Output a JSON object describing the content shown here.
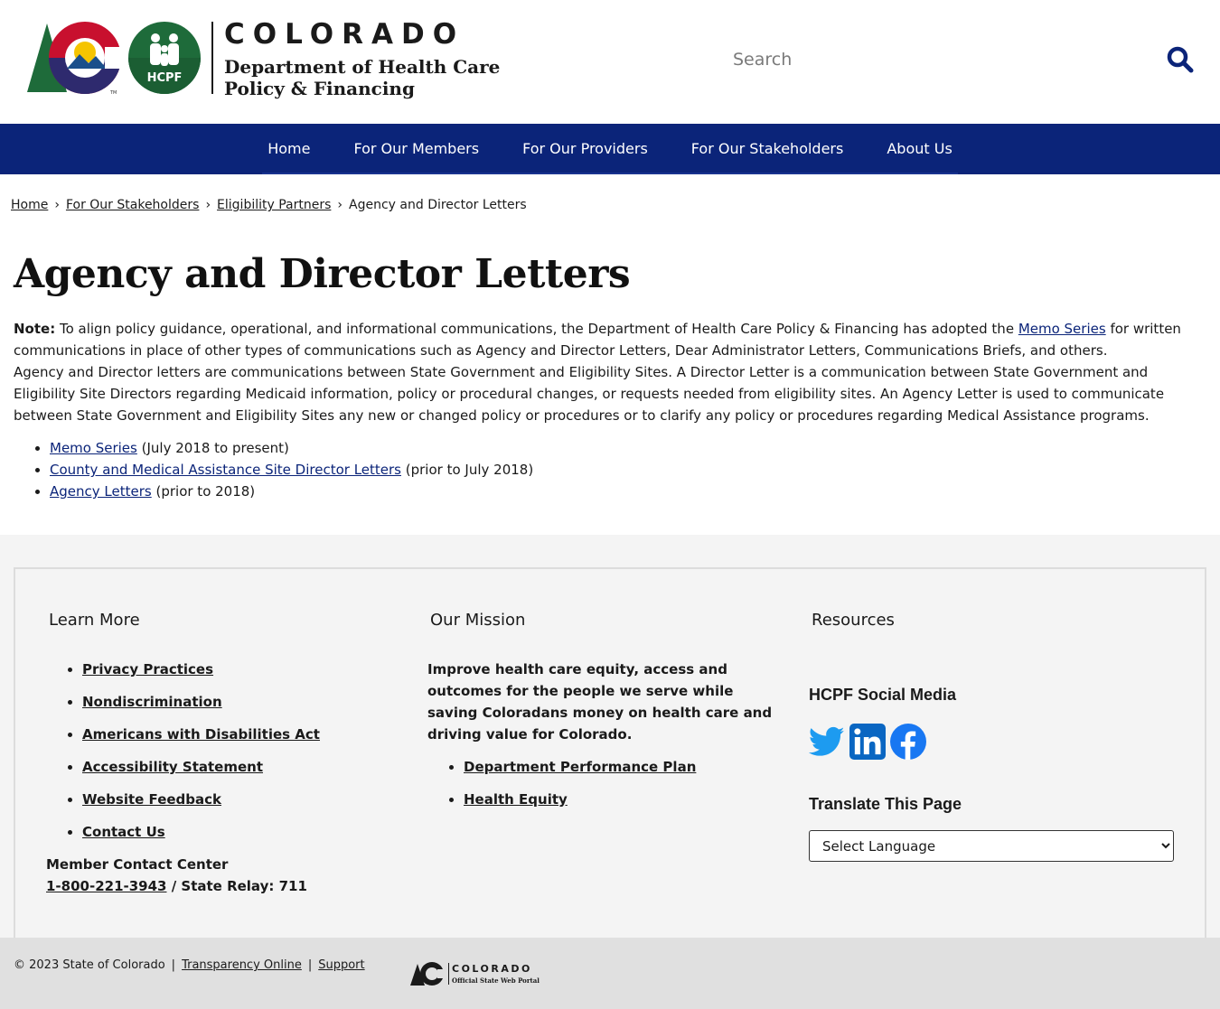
{
  "header": {
    "logo_wordmark": "COLORADO",
    "logo_dept_line1": "Department of Health Care",
    "logo_dept_line2": "Policy & Financing",
    "hcpf_badge": "HCPF",
    "search_placeholder": "Search",
    "search_icon": "search-icon"
  },
  "nav": {
    "items": [
      "Home",
      "For Our Members",
      "For Our Providers",
      "For Our Stakeholders",
      "About Us"
    ]
  },
  "breadcrumb": {
    "items": [
      "Home",
      "For Our Stakeholders",
      "Eligibility Partners"
    ],
    "current": "Agency and Director Letters",
    "separator": "›"
  },
  "main": {
    "title": "Agency and Director Letters",
    "note_label": "Note:",
    "note_text_before": " To align policy guidance, operational, and informational communications, the Department of Health Care Policy & Financing has adopted the ",
    "note_link": "Memo Series",
    "note_text_after": " for written communications in place of other types of communications such as Agency and Director Letters, Dear Administrator Letters, Communications Briefs, and others.",
    "paragraph": "Agency and Director letters are communications between State Government and Eligibility Sites. A Director Letter is a communication between State Government and Eligibility Site Directors regarding Medicaid information, policy or procedural changes, or requests needed from eligibility sites. An Agency Letter is used to communicate between State Government and Eligibility Sites any new or changed policy or procedures or to clarify any policy or procedures regarding Medical Assistance programs.",
    "links": [
      {
        "label": "Memo Series",
        "note": " (July 2018 to present)"
      },
      {
        "label": "County and Medical Assistance Site Director Letters",
        "note": " (prior to July 2018)"
      },
      {
        "label": "Agency Letters",
        "note": " (prior to 2018)"
      }
    ]
  },
  "footer": {
    "learn_more": {
      "heading": "Learn More",
      "links": [
        "Privacy Practices",
        "Nondiscrimination",
        "Americans with Disabilities Act",
        "Accessibility Statement",
        "Website Feedback",
        "Contact Us"
      ],
      "contact_label": "Member Contact Center",
      "contact_phone": "1-800-221-3943",
      "contact_relay": " / State Relay: 711"
    },
    "mission": {
      "heading": "Our Mission",
      "text": "Improve health care equity, access and outcomes for the people we serve while saving Coloradans money on health care and driving value for Colorado.",
      "links": [
        "Department Performance Plan",
        "Health Equity"
      ]
    },
    "resources": {
      "heading": "Resources",
      "social_heading": "HCPF Social Media",
      "social_icons": [
        "twitter-icon",
        "linkedin-icon",
        "facebook-icon"
      ],
      "translate_heading": "Translate This Page",
      "language_selected": "Select Language"
    }
  },
  "bottom": {
    "copyright": "© 2023 State of Colorado",
    "links": [
      "Transparency Online",
      "Support"
    ],
    "portal_line1": "COLORADO",
    "portal_line2": "Official State Web Portal"
  },
  "colors": {
    "nav_bg": "#0b2479",
    "link": "#0b2479",
    "footer_bg": "#f4f4f4",
    "bottom_bg": "#e0e0e0",
    "twitter": "#1d9bf0",
    "linkedin": "#0a66c2",
    "facebook": "#1877f2"
  }
}
